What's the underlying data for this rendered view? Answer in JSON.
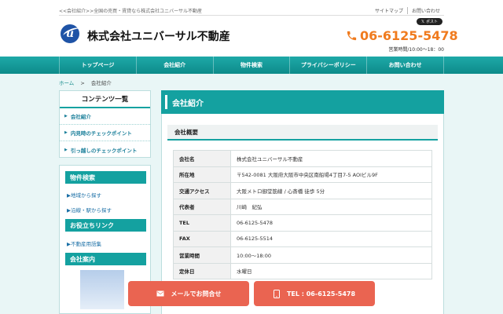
{
  "header": {
    "tagline": "<<会社紹介>>全国の売買・賃貸なら株式会社ユニバーサル不動産",
    "links": [
      "サイトマップ",
      "お問い合わせ"
    ],
    "post_button": "ポスト",
    "logo_letter": "u",
    "company_name": "株式会社ユニバーサル不動産",
    "phone": "06-6125-5478",
    "hours": "営業時間/10:00～18：00"
  },
  "nav": {
    "items": [
      "トップページ",
      "会社紹介",
      "物件検索",
      "プライバシーポリシー",
      "お問い合わせ"
    ]
  },
  "breadcrumb": {
    "home": "ホーム",
    "sep": ">",
    "current": "会社紹介"
  },
  "sidebar": {
    "contents_title": "コンテンツ一覧",
    "contents_items": [
      "会社紹介",
      "内見時のチェックポイント",
      "引っ越しのチェックポイント"
    ],
    "search_title": "物件検索",
    "search_links": [
      "▶地域から探す",
      "▶沿線・駅から探す"
    ],
    "useful_title": "お役立ちリンク",
    "useful_links": [
      "▶不動産用語集"
    ],
    "company_title": "会社案内"
  },
  "main": {
    "title": "会社紹介",
    "section_title": "会社概要",
    "rows": [
      {
        "label": "会社名",
        "value": "株式会社ユニバーサル不動産"
      },
      {
        "label": "所在地",
        "value": "〒542-0081 大阪府大阪市中央区南船場4丁目7-5 AOIビル9F"
      },
      {
        "label": "交通アクセス",
        "value": "大阪メトロ御堂筋線 / 心斎橋 徒歩 5分"
      },
      {
        "label": "代表者",
        "value": "川崎　紀弘"
      },
      {
        "label": "TEL",
        "value": "06-6125-5478"
      },
      {
        "label": "FAX",
        "value": "06-6125-5514"
      },
      {
        "label": "営業時間",
        "value": "10:00～18:00"
      },
      {
        "label": "定休日",
        "value": "水曜日"
      }
    ]
  },
  "footer_buttons": {
    "mail": "メールでお問合せ",
    "tel": "TEL : 06-6125-5478"
  },
  "colors": {
    "accent": "#14a1a0",
    "phone": "#f07b1e",
    "cta": "#ea6451"
  }
}
